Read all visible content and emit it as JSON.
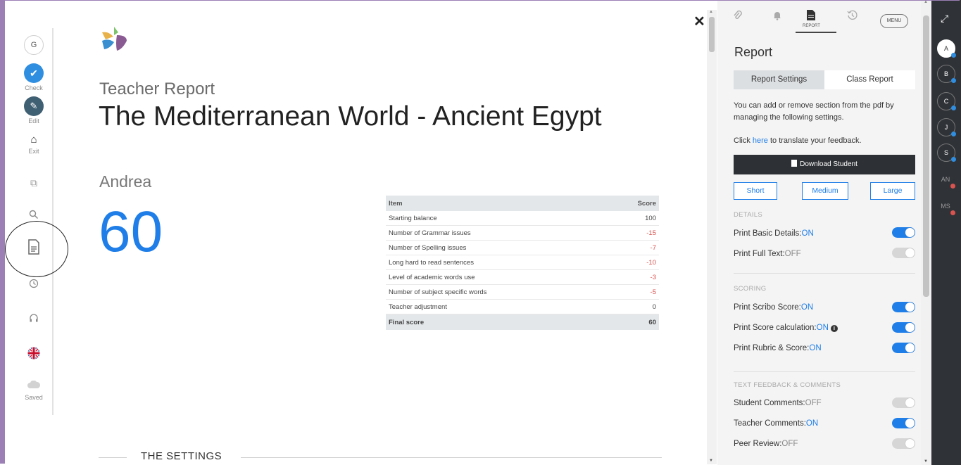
{
  "left_toolbar": {
    "grammar_label": "G",
    "check_label": "Check",
    "edit_label": "Edit",
    "exit_label": "Exit",
    "saved_label": "Saved"
  },
  "report": {
    "kicker": "Teacher Report",
    "title": "The Mediterranean World - Ancient Egypt",
    "student": "Andrea",
    "score": "60",
    "table": {
      "headers": [
        "Item",
        "Score"
      ],
      "rows": [
        {
          "item": "Starting balance",
          "score": "100"
        },
        {
          "item": "Number of Grammar issues",
          "score": "-15"
        },
        {
          "item": "Number of Spelling issues",
          "score": "-7"
        },
        {
          "item": "Long hard to read sentences",
          "score": "-10"
        },
        {
          "item": "Level of academic words use",
          "score": "-3"
        },
        {
          "item": "Number of subject specific words",
          "score": "-5"
        },
        {
          "item": "Teacher adjustment",
          "score": "0"
        }
      ],
      "final": {
        "item": "Final score",
        "score": "60"
      }
    },
    "settings_heading": "THE SETTINGS"
  },
  "close_symbol": "✕",
  "panel": {
    "tabs": {
      "report_sub": "REPORT",
      "menu": "MENU"
    },
    "title": "Report",
    "segments": [
      "Report Settings",
      "Class Report"
    ],
    "intro": "You can add or remove section from the pdf by managing the following settings.",
    "translate_prefix": "Click ",
    "translate_link": "here",
    "translate_suffix": " to translate your feedback.",
    "download": "Download Student",
    "sizes": [
      "Short",
      "Medium",
      "Large"
    ],
    "details_head": "DETAILS",
    "scoring_head": "SCORING",
    "feedback_head": "TEXT FEEDBACK & COMMENTS",
    "options": {
      "basic": {
        "label": "Print Basic Details:",
        "state": "ON"
      },
      "full": {
        "label": "Print Full Text:",
        "state": "OFF"
      },
      "scribo": {
        "label": "Print Scribo Score:",
        "state": "ON"
      },
      "calc": {
        "label": "Print Score calculation:",
        "state": "ON"
      },
      "rubric": {
        "label": "Print Rubric & Score:",
        "state": "ON"
      },
      "student_comments": {
        "label": "Student Comments:",
        "state": "OFF"
      },
      "teacher_comments": {
        "label": "Teacher Comments:",
        "state": "ON"
      },
      "peer": {
        "label": "Peer Review:",
        "state": "OFF"
      }
    }
  },
  "students": [
    {
      "initials": "A",
      "dot": "#2f8ee0"
    },
    {
      "initials": "B",
      "dot": "#2f8ee0"
    },
    {
      "initials": "C",
      "dot": "#2f8ee0"
    },
    {
      "initials": "J",
      "dot": "#2f8ee0"
    },
    {
      "initials": "S",
      "dot": "#2f8ee0"
    },
    {
      "initials": "AN",
      "dot": "#d9534f"
    },
    {
      "initials": "MS",
      "dot": "#d9534f"
    }
  ],
  "colors": {
    "accent": "#1f7ee8",
    "negative": "#d9534f"
  }
}
